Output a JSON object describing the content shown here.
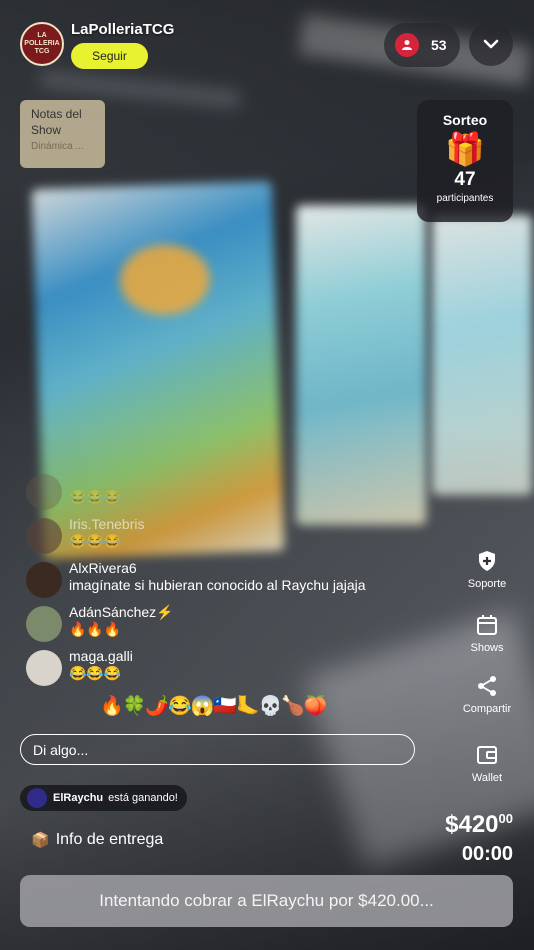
{
  "header": {
    "host_name": "LaPolleriaTCG",
    "avatar_text": "LA POLLERIA TCG",
    "follow_label": "Seguir",
    "viewer_count": "53"
  },
  "notes": {
    "title": "Notas del Show",
    "subtitle": "Dinámica ..."
  },
  "raffle": {
    "title": "Sorteo",
    "gift_icon": "🎁",
    "count": "47",
    "label": "participantes"
  },
  "chat": [
    {
      "user": "",
      "text": "😂😂😂",
      "avatar_color": "#6a5a4a"
    },
    {
      "user": "Iris.Tenebris",
      "text": "😂😂😂",
      "avatar_color": "#5a4038"
    },
    {
      "user": "AlxRivera6",
      "text": "imagínate si hubieran conocido al Raychu jajaja",
      "avatar_color": "#3a2a22"
    },
    {
      "user": "AdánSánchez⚡",
      "text": "🔥🔥🔥",
      "avatar_color": "#7a8a6a"
    },
    {
      "user": "maga.galli",
      "text": "😂😂😂",
      "avatar_color": "#d8d4cc"
    }
  ],
  "side_actions": [
    {
      "label": "Soporte",
      "icon": "shield-plus-icon"
    },
    {
      "label": "Shows",
      "icon": "calendar-icon"
    },
    {
      "label": "Compartir",
      "icon": "share-icon"
    },
    {
      "label": "Wallet",
      "icon": "wallet-icon"
    }
  ],
  "reactions": "🔥🍀🌶️😂😱🇨🇱🦶💀🍗🍑",
  "input": {
    "placeholder": "Di algo..."
  },
  "winner": {
    "name": "ElRaychu",
    "text": "está ganando!"
  },
  "delivery": {
    "icon": "📦",
    "label": "Info de entrega"
  },
  "price": {
    "main": "$420",
    "cents": "00"
  },
  "timer": "00:00",
  "pay_bar": "Intentando cobrar a ElRaychu por $420.00...",
  "colors": {
    "follow_bg": "#e8f230",
    "viewer_dot": "#d8243a"
  }
}
